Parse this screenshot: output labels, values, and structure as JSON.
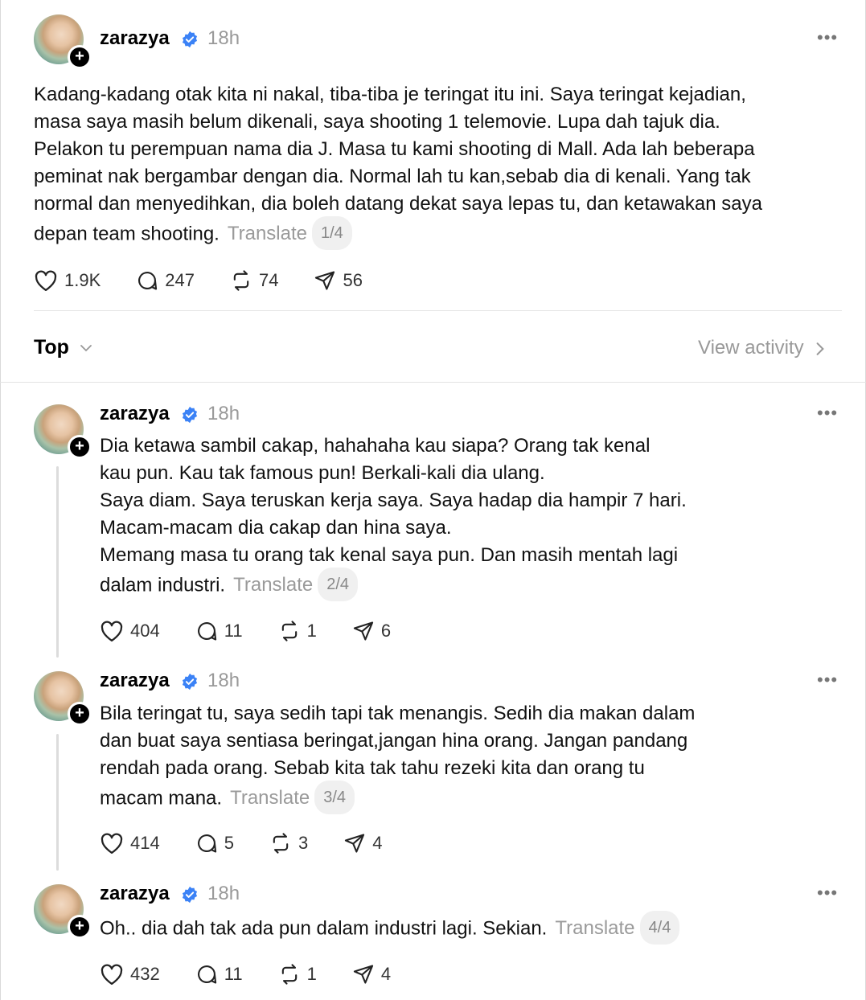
{
  "post": {
    "username": "zarazya",
    "time": "18h",
    "more_icon": "more-dots-icon",
    "text": "Kadang-kadang otak kita ni nakal, tiba-tiba je teringat itu ini. Saya teringat kejadian, masa saya masih belum dikenali, saya shooting 1 telemovie. Lupa dah tajuk dia. Pelakon tu perempuan nama dia J. Masa tu kami shooting di Mall. Ada lah beberapa peminat nak bergambar dengan dia. Normal lah tu kan,sebab dia di kenali. Yang tak normal dan menyedihkan, dia boleh datang dekat saya lepas tu, dan ketawakan saya depan team shooting.",
    "translate": "Translate",
    "page": "1/4",
    "likes": "1.9K",
    "replies": "247",
    "reposts": "74",
    "shares": "56"
  },
  "sort": {
    "label": "Top",
    "view_activity": "View activity"
  },
  "replies": [
    {
      "username": "zarazya",
      "time": "18h",
      "lines": [
        "Dia ketawa sambil cakap, hahahaha kau siapa? Orang tak kenal",
        "kau pun. Kau tak famous pun! Berkali-kali dia ulang.",
        "Saya diam. Saya teruskan kerja saya. Saya hadap dia hampir 7 hari.",
        "Macam-macam dia cakap dan hina saya.",
        "Memang masa tu orang tak kenal saya pun. Dan masih mentah lagi",
        "dalam industri."
      ],
      "translate": "Translate",
      "page": "2/4",
      "likes": "404",
      "replies": "11",
      "reposts": "1",
      "shares": "6"
    },
    {
      "username": "zarazya",
      "time": "18h",
      "lines": [
        "Bila teringat tu, saya sedih tapi tak menangis. Sedih dia makan dalam",
        "dan buat saya sentiasa beringat,jangan hina orang. Jangan pandang",
        "rendah pada orang. Sebab kita tak tahu rezeki kita dan orang tu",
        "macam mana."
      ],
      "translate": "Translate",
      "page": "3/4",
      "likes": "414",
      "replies": "5",
      "reposts": "3",
      "shares": "4"
    },
    {
      "username": "zarazya",
      "time": "18h",
      "lines": [
        "Oh.. dia dah tak ada pun dalam industri lagi. Sekian."
      ],
      "translate": "Translate",
      "page": "4/4",
      "likes": "432",
      "replies": "11",
      "reposts": "1",
      "shares": "4"
    }
  ],
  "colors": {
    "verified": "#3b82f6",
    "muted": "#999999",
    "divider": "#e3e3e3"
  }
}
